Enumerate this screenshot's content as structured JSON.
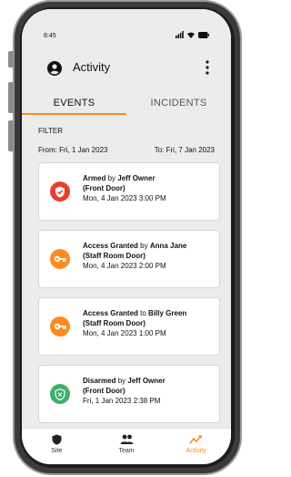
{
  "status_bar": {
    "time": "8:45"
  },
  "header": {
    "title": "Activity",
    "avatar_icon": "user-icon",
    "more_icon": "kebab-menu-icon"
  },
  "tabs": [
    {
      "label": "EVENTS",
      "active": true
    },
    {
      "label": "INCIDENTS",
      "active": false
    }
  ],
  "filter": {
    "label": "FILTER",
    "from": "From: Fri, 1 Jan 2023",
    "to": "To: Fri, 7 Jan 2023"
  },
  "events": [
    {
      "action": "Armed",
      "connector": " by ",
      "person": "Jeff Owner",
      "door": "(Front Door)",
      "time": "Mon, 4 Jan 2023 3:00 PM",
      "icon": "shield-check-icon",
      "icon_color": "#e8402a"
    },
    {
      "action": "Access Granted",
      "connector": " by ",
      "person": "Anna Jane",
      "door": "(Staff Room Door)",
      "time": "Mon, 4 Jan 2023 2:00 PM",
      "icon": "key-icon",
      "icon_color": "#ff8a1f"
    },
    {
      "action": "Access Granted",
      "connector": " to ",
      "person": "Billy Green",
      "door": "(Staff Room Door)",
      "time": "Mon, 4 Jan 2023 1:00 PM",
      "icon": "key-icon",
      "icon_color": "#ff8a1f"
    },
    {
      "action": "Disarmed",
      "connector": " by ",
      "person": "Jeff Owner",
      "door": "(Front Door)",
      "time": "Fri, 1 Jan 2023 2:38 PM",
      "icon": "shield-x-icon",
      "icon_color": "#3fae6a"
    }
  ],
  "bottom_nav": [
    {
      "label": "Site",
      "icon": "shield-icon",
      "active": false
    },
    {
      "label": "Team",
      "icon": "people-icon",
      "active": false
    },
    {
      "label": "Activity",
      "icon": "activity-icon",
      "active": true
    }
  ],
  "colors": {
    "accent": "#ff8a1f",
    "background": "#ececec"
  }
}
